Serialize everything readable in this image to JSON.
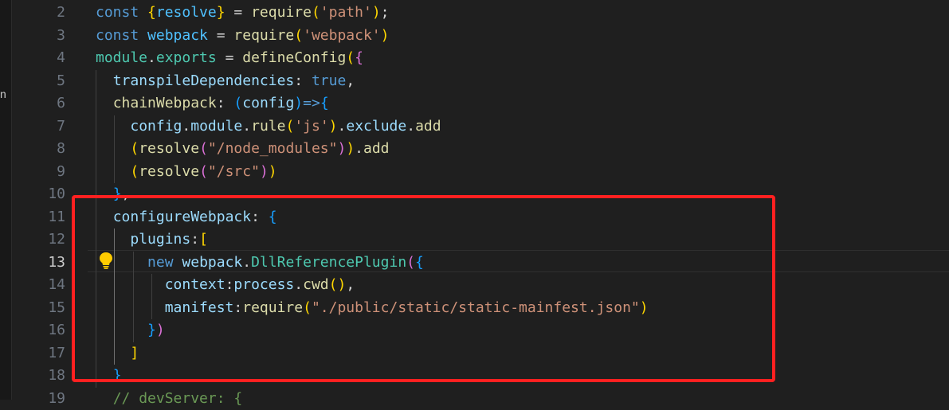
{
  "sidebar": {
    "fragment": "n"
  },
  "gutter": {
    "line_numbers": [
      "2",
      "3",
      "4",
      "5",
      "6",
      "7",
      "8",
      "9",
      "10",
      "11",
      "12",
      "13",
      "14",
      "15",
      "16",
      "17",
      "18",
      "19"
    ]
  },
  "code": {
    "lines": [
      [
        {
          "t": "const",
          "c": "kw"
        },
        {
          "t": " ",
          "c": "p"
        },
        {
          "t": "{",
          "c": "b1"
        },
        {
          "t": "resolve",
          "c": "const"
        },
        {
          "t": "}",
          "c": "b1"
        },
        {
          "t": " = ",
          "c": "p"
        },
        {
          "t": "require",
          "c": "fn"
        },
        {
          "t": "(",
          "c": "b1"
        },
        {
          "t": "'path'",
          "c": "str"
        },
        {
          "t": ")",
          "c": "b1"
        },
        {
          "t": ";",
          "c": "p"
        }
      ],
      [
        {
          "t": "const",
          "c": "kw"
        },
        {
          "t": " ",
          "c": "p"
        },
        {
          "t": "webpack",
          "c": "const"
        },
        {
          "t": " = ",
          "c": "p"
        },
        {
          "t": "require",
          "c": "fn"
        },
        {
          "t": "(",
          "c": "b1"
        },
        {
          "t": "'webpack'",
          "c": "str"
        },
        {
          "t": ")",
          "c": "b1"
        }
      ],
      [
        {
          "t": "module",
          "c": "cls"
        },
        {
          "t": ".",
          "c": "p"
        },
        {
          "t": "exports",
          "c": "cls"
        },
        {
          "t": " = ",
          "c": "p"
        },
        {
          "t": "defineConfig",
          "c": "fn"
        },
        {
          "t": "(",
          "c": "b1"
        },
        {
          "t": "{",
          "c": "b2"
        }
      ],
      [
        {
          "t": "  ",
          "c": "p"
        },
        {
          "t": "transpileDependencies",
          "c": "var"
        },
        {
          "t": ": ",
          "c": "p"
        },
        {
          "t": "true",
          "c": "kw"
        },
        {
          "t": ",",
          "c": "p"
        }
      ],
      [
        {
          "t": "  ",
          "c": "p"
        },
        {
          "t": "chainWebpack",
          "c": "fn"
        },
        {
          "t": ": ",
          "c": "p"
        },
        {
          "t": "(",
          "c": "b3"
        },
        {
          "t": "config",
          "c": "var"
        },
        {
          "t": ")",
          "c": "b3"
        },
        {
          "t": "=>",
          "c": "kw"
        },
        {
          "t": "{",
          "c": "b3"
        }
      ],
      [
        {
          "t": "    ",
          "c": "p"
        },
        {
          "t": "config",
          "c": "var"
        },
        {
          "t": ".",
          "c": "p"
        },
        {
          "t": "module",
          "c": "var"
        },
        {
          "t": ".",
          "c": "p"
        },
        {
          "t": "rule",
          "c": "fn"
        },
        {
          "t": "(",
          "c": "b1"
        },
        {
          "t": "'js'",
          "c": "str"
        },
        {
          "t": ")",
          "c": "b1"
        },
        {
          "t": ".",
          "c": "p"
        },
        {
          "t": "exclude",
          "c": "var"
        },
        {
          "t": ".",
          "c": "p"
        },
        {
          "t": "add",
          "c": "fn"
        }
      ],
      [
        {
          "t": "    ",
          "c": "p"
        },
        {
          "t": "(",
          "c": "b1"
        },
        {
          "t": "resolve",
          "c": "fn"
        },
        {
          "t": "(",
          "c": "b2"
        },
        {
          "t": "\"/node_modules\"",
          "c": "str"
        },
        {
          "t": ")",
          "c": "b2"
        },
        {
          "t": ")",
          "c": "b1"
        },
        {
          "t": ".",
          "c": "p"
        },
        {
          "t": "add",
          "c": "fn"
        }
      ],
      [
        {
          "t": "    ",
          "c": "p"
        },
        {
          "t": "(",
          "c": "b1"
        },
        {
          "t": "resolve",
          "c": "fn"
        },
        {
          "t": "(",
          "c": "b2"
        },
        {
          "t": "\"/src\"",
          "c": "str"
        },
        {
          "t": ")",
          "c": "b2"
        },
        {
          "t": ")",
          "c": "b1"
        }
      ],
      [
        {
          "t": "  ",
          "c": "p"
        },
        {
          "t": "}",
          "c": "b3"
        },
        {
          "t": ",",
          "c": "p"
        }
      ],
      [
        {
          "t": "  ",
          "c": "p"
        },
        {
          "t": "configureWebpack",
          "c": "var"
        },
        {
          "t": ": ",
          "c": "p"
        },
        {
          "t": "{",
          "c": "b3"
        }
      ],
      [
        {
          "t": "    ",
          "c": "p"
        },
        {
          "t": "plugins",
          "c": "var"
        },
        {
          "t": ":",
          "c": "p"
        },
        {
          "t": "[",
          "c": "b1"
        }
      ],
      [
        {
          "t": "      ",
          "c": "p"
        },
        {
          "t": "new",
          "c": "kw"
        },
        {
          "t": " ",
          "c": "p"
        },
        {
          "t": "webpack",
          "c": "var"
        },
        {
          "t": ".",
          "c": "p"
        },
        {
          "t": "DllReferencePlugin",
          "c": "cls"
        },
        {
          "t": "(",
          "c": "b2"
        },
        {
          "t": "{",
          "c": "b3"
        }
      ],
      [
        {
          "t": "        ",
          "c": "p"
        },
        {
          "t": "context",
          "c": "var"
        },
        {
          "t": ":",
          "c": "p"
        },
        {
          "t": "process",
          "c": "var"
        },
        {
          "t": ".",
          "c": "p"
        },
        {
          "t": "cwd",
          "c": "fn"
        },
        {
          "t": "(",
          "c": "b1"
        },
        {
          "t": ")",
          "c": "b1"
        },
        {
          "t": ",",
          "c": "p"
        }
      ],
      [
        {
          "t": "        ",
          "c": "p"
        },
        {
          "t": "manifest",
          "c": "var"
        },
        {
          "t": ":",
          "c": "p"
        },
        {
          "t": "require",
          "c": "fn"
        },
        {
          "t": "(",
          "c": "b1"
        },
        {
          "t": "\"./public/static/static-mainfest.json\"",
          "c": "str"
        },
        {
          "t": ")",
          "c": "b1"
        }
      ],
      [
        {
          "t": "      ",
          "c": "p"
        },
        {
          "t": "}",
          "c": "b3"
        },
        {
          "t": ")",
          "c": "b2"
        }
      ],
      [
        {
          "t": "    ",
          "c": "p"
        },
        {
          "t": "]",
          "c": "b1"
        }
      ],
      [
        {
          "t": "  ",
          "c": "p"
        },
        {
          "t": "}",
          "c": "b3"
        }
      ],
      [
        {
          "t": "  ",
          "c": "p"
        },
        {
          "t": "// devServer: {",
          "c": "cmt"
        }
      ]
    ]
  },
  "colors": {
    "background": "#1f1f1f",
    "highlight_box": "#ff2020",
    "lightbulb": "#ffcc00"
  },
  "icons": {
    "gutter_action": "lightbulb-icon"
  }
}
